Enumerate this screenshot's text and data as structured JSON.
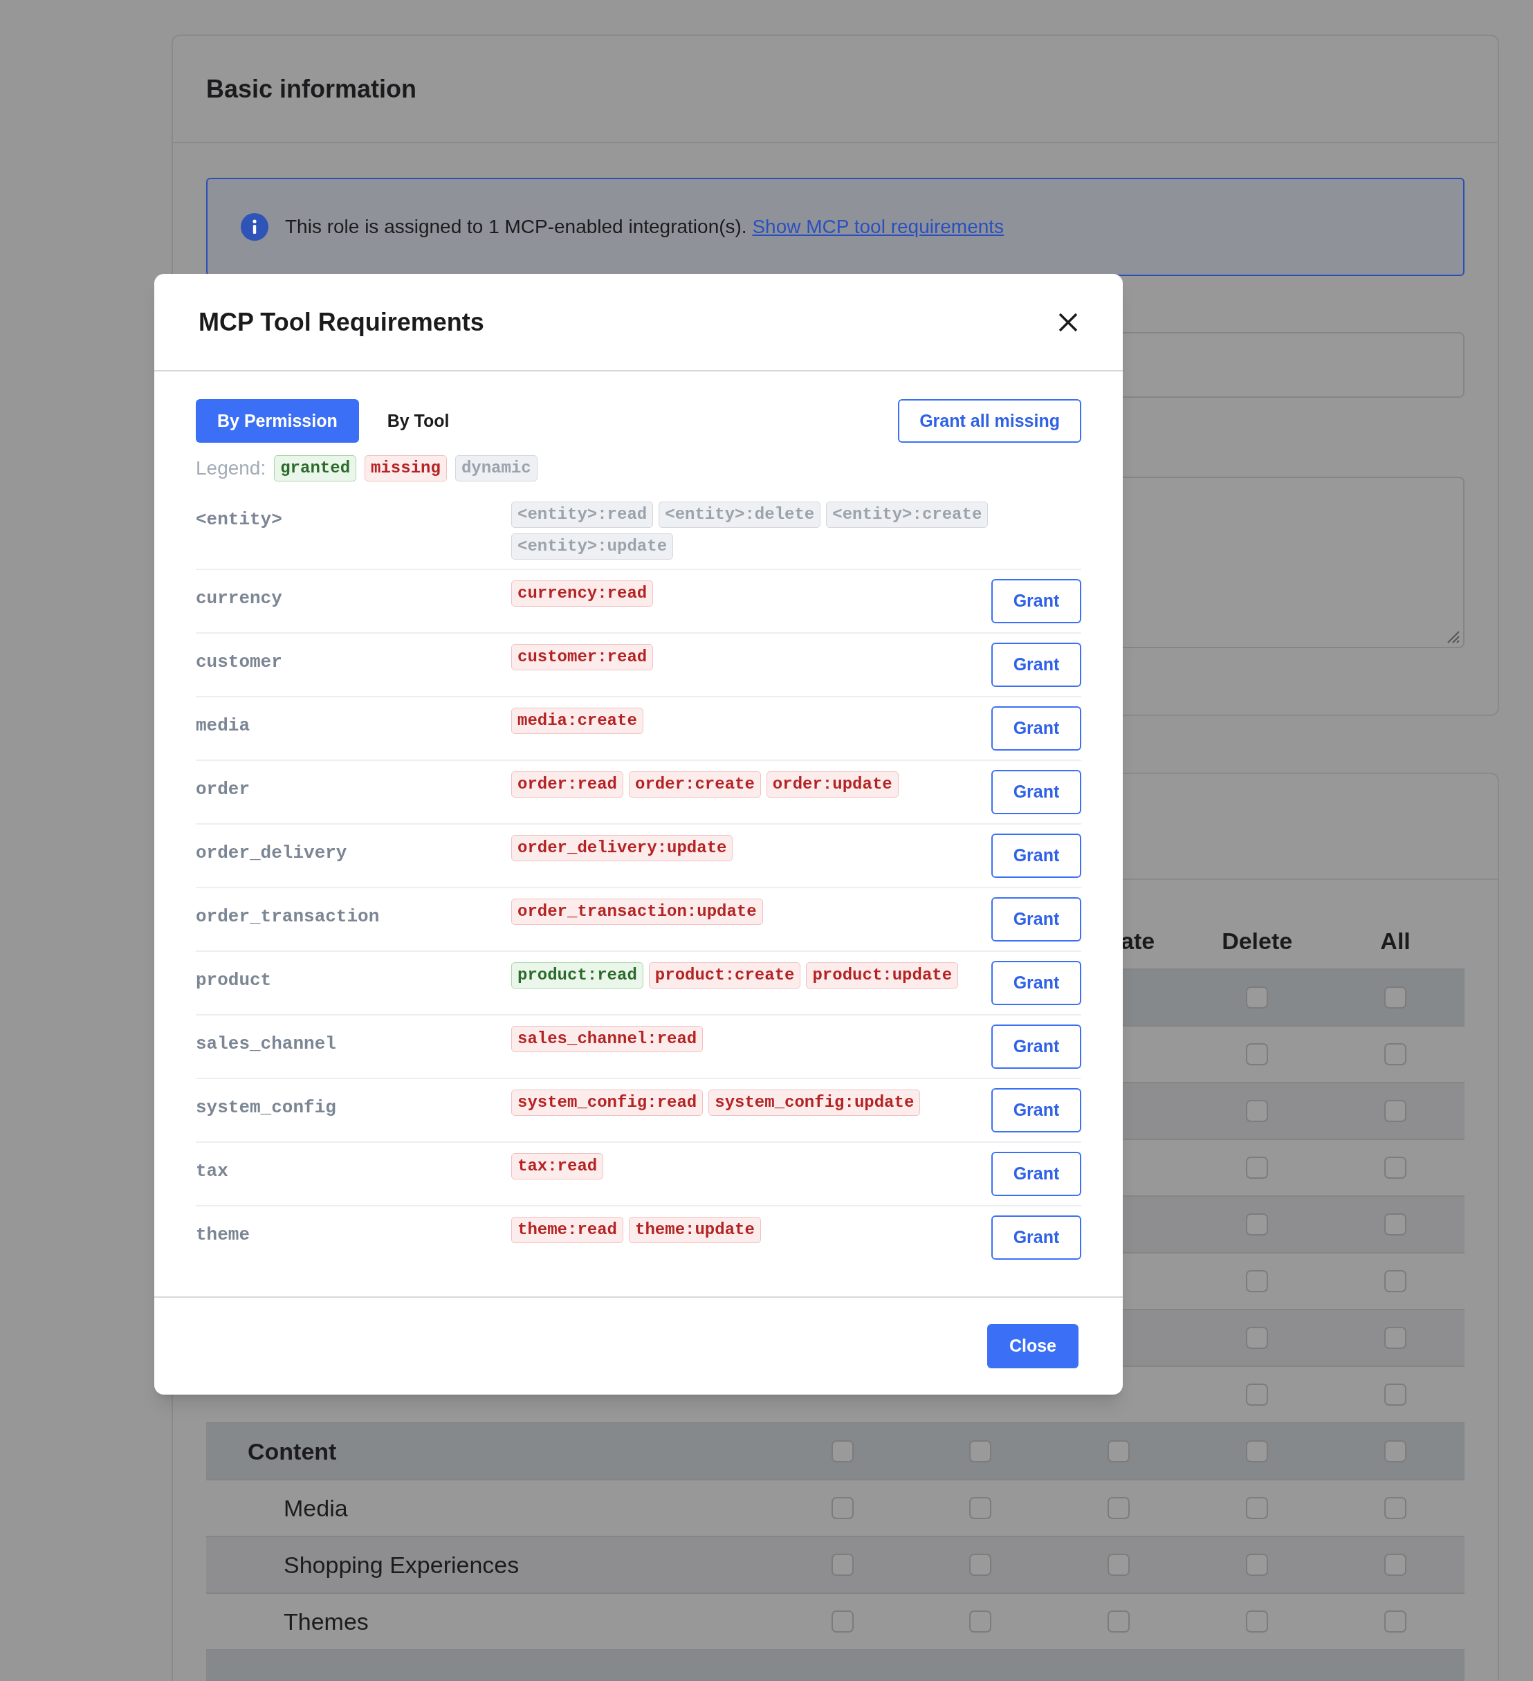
{
  "background": {
    "card_title": "Basic information",
    "alert": {
      "text": "This role is assigned to 1 MCP-enabled integration(s).",
      "link": "Show MCP tool requirements"
    },
    "table": {
      "columns": [
        "ate",
        "Delete",
        "All"
      ],
      "rows": [
        {
          "kind": "category",
          "checks": [
            false,
            false
          ]
        },
        {
          "kind": "item",
          "checks": [
            false,
            false
          ]
        },
        {
          "kind": "item",
          "checks": [
            false,
            false
          ]
        },
        {
          "kind": "item",
          "checks": [
            false,
            false
          ]
        },
        {
          "kind": "item",
          "checks": [
            false,
            false
          ]
        },
        {
          "kind": "item",
          "checks": [
            false,
            false
          ]
        },
        {
          "kind": "item",
          "checks": [
            false,
            false
          ]
        },
        {
          "kind": "item",
          "checks": [
            false,
            false
          ]
        },
        {
          "kind": "category",
          "label": "Content",
          "checks": [
            false,
            false,
            false,
            false,
            false
          ]
        },
        {
          "kind": "item",
          "label": "Media",
          "checks": [
            false,
            false,
            false,
            false,
            false
          ]
        },
        {
          "kind": "item",
          "label": "Shopping Experiences",
          "checks": [
            false,
            false,
            false,
            false,
            false
          ]
        },
        {
          "kind": "item",
          "label": "Themes",
          "checks": [
            false,
            false,
            false,
            false,
            false
          ]
        },
        {
          "kind": "category"
        }
      ]
    }
  },
  "modal": {
    "title": "MCP Tool Requirements",
    "tabs": [
      {
        "label": "By Permission",
        "selected": true
      },
      {
        "label": "By Tool",
        "selected": false
      }
    ],
    "grant_all_button": "Grant all missing",
    "legend": {
      "label": "Legend:",
      "items": [
        {
          "text": "granted",
          "kind": "granted"
        },
        {
          "text": "missing",
          "kind": "missing"
        },
        {
          "text": "dynamic",
          "kind": "dynamic"
        }
      ]
    },
    "rows": [
      {
        "entity": "<entity>",
        "permissions": [
          {
            "text": "<entity>:read",
            "kind": "dynamic"
          },
          {
            "text": "<entity>:delete",
            "kind": "dynamic"
          },
          {
            "text": "<entity>:create",
            "kind": "dynamic"
          },
          {
            "text": "<entity>:update",
            "kind": "dynamic"
          }
        ]
      },
      {
        "entity": "currency",
        "permissions": [
          {
            "text": "currency:read",
            "kind": "missing"
          }
        ],
        "button": "Grant"
      },
      {
        "entity": "customer",
        "permissions": [
          {
            "text": "customer:read",
            "kind": "missing"
          }
        ],
        "button": "Grant"
      },
      {
        "entity": "media",
        "permissions": [
          {
            "text": "media:create",
            "kind": "missing"
          }
        ],
        "button": "Grant"
      },
      {
        "entity": "order",
        "permissions": [
          {
            "text": "order:read",
            "kind": "missing"
          },
          {
            "text": "order:create",
            "kind": "missing"
          },
          {
            "text": "order:update",
            "kind": "missing"
          }
        ],
        "button": "Grant"
      },
      {
        "entity": "order_delivery",
        "permissions": [
          {
            "text": "order_delivery:update",
            "kind": "missing"
          }
        ],
        "button": "Grant"
      },
      {
        "entity": "order_transaction",
        "permissions": [
          {
            "text": "order_transaction:update",
            "kind": "missing"
          }
        ],
        "button": "Grant"
      },
      {
        "entity": "product",
        "permissions": [
          {
            "text": "product:read",
            "kind": "granted"
          },
          {
            "text": "product:create",
            "kind": "missing"
          },
          {
            "text": "product:update",
            "kind": "missing"
          }
        ],
        "button": "Grant"
      },
      {
        "entity": "sales_channel",
        "permissions": [
          {
            "text": "sales_channel:read",
            "kind": "missing"
          }
        ],
        "button": "Grant"
      },
      {
        "entity": "system_config",
        "permissions": [
          {
            "text": "system_config:read",
            "kind": "missing"
          },
          {
            "text": "system_config:update",
            "kind": "missing"
          }
        ],
        "button": "Grant"
      },
      {
        "entity": "tax",
        "permissions": [
          {
            "text": "tax:read",
            "kind": "missing"
          }
        ],
        "button": "Grant"
      },
      {
        "entity": "theme",
        "permissions": [
          {
            "text": "theme:read",
            "kind": "missing"
          },
          {
            "text": "theme:update",
            "kind": "missing"
          }
        ],
        "button": "Grant"
      }
    ],
    "close_button": "Close"
  }
}
